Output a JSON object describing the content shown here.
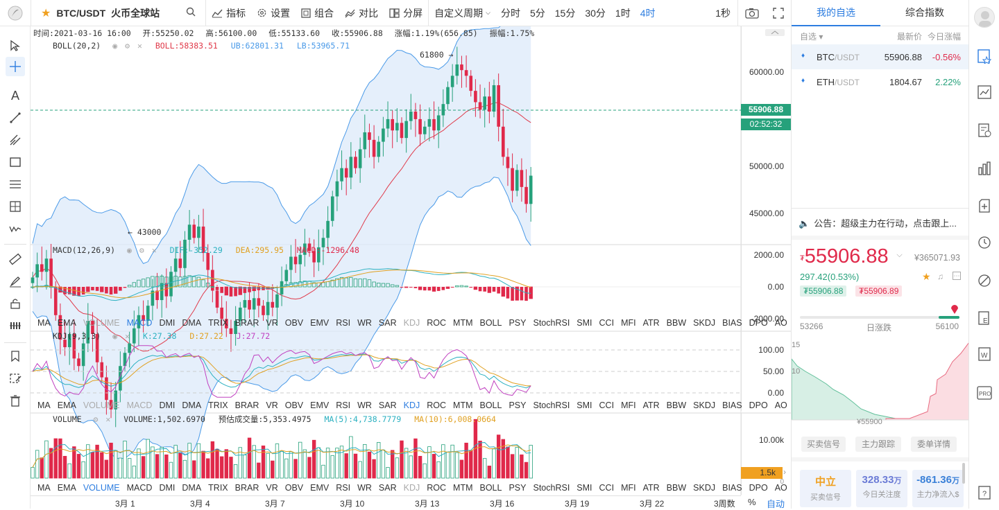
{
  "topbar": {
    "symbol": "BTC/USDT",
    "site": "火币全球站",
    "indicators_label": "指标",
    "settings_label": "设置",
    "combine_label": "组合",
    "compare_label": "对比",
    "split_label": "分屏",
    "custom_period_label": "自定义周期",
    "periods": [
      "分时",
      "5分",
      "15分",
      "30分",
      "1时",
      "4时"
    ],
    "active_period": "4时",
    "second_label": "1秒"
  },
  "info": {
    "time_label": "时间:",
    "time": "2021-03-16 16:00",
    "open_label": "开:",
    "open": "55250.02",
    "high_label": "高:",
    "high": "56100.00",
    "low_label": "低:",
    "low": "55133.60",
    "close_label": "收:",
    "close": "55906.88",
    "change_label": "涨幅:",
    "change": "1.19%(656.85)",
    "amp_label": "振幅:",
    "amp": "1.75%"
  },
  "boll": {
    "name": "BOLL(20,2)",
    "boll": "BOLL:58383.51",
    "ub": "UB:62801.31",
    "lb": "LB:53965.71",
    "max_mark": "61800",
    "min_mark": "43000"
  },
  "price_axis": [
    "60000.00",
    "55906.88",
    "50000.00",
    "45000.00"
  ],
  "countdown": "02:52:32",
  "macd": {
    "name": "MACD(12,26,9)",
    "dif": "DIF:-352.29",
    "dea": "DEA:295.95",
    "macd": "MACD:-1296.48",
    "axis": [
      "2000.00",
      "0.00",
      "-2000.00"
    ]
  },
  "kdj": {
    "name": "KDJ(9,3,3)",
    "k": "K:27.38",
    "d": "D:27.22",
    "j": "J:27.72",
    "axis": [
      "100.00",
      "50.00",
      "0.00"
    ]
  },
  "volume": {
    "name": "VOLUME",
    "vol": "VOLUME:1,502.6970",
    "est": "预估成交量:5,353.4975",
    "ma5": "MA(5):4,738.7779",
    "ma10": "MA(10):6,008.0664",
    "axis": [
      "10.00k",
      "1.5k",
      "0"
    ]
  },
  "indicator_tabs": [
    "MA",
    "EMA",
    "VOLUME",
    "MACD",
    "DMI",
    "DMA",
    "TRIX",
    "BRAR",
    "VR",
    "OBV",
    "EMV",
    "RSI",
    "WR",
    "SAR",
    "KDJ",
    "ROC",
    "MTM",
    "BOLL",
    "PSY",
    "StochRSI",
    "SMI",
    "CCI",
    "MFI",
    "ATR",
    "BBW",
    "SKDJ",
    "BIAS",
    "DPO",
    "AO"
  ],
  "date_axis": [
    "3月 1",
    "3月 4",
    "3月 7",
    "3月 10",
    "3月 13",
    "3月 16",
    "3月 19",
    "3月 22",
    "3周数"
  ],
  "bottom_right": {
    "percent": "%",
    "auto": "自动"
  },
  "watchlist": {
    "tab_mine": "我的自选",
    "tab_index": "综合指数",
    "col_select": "自选",
    "col_price": "最新价",
    "col_change": "今日涨幅",
    "rows": [
      {
        "base": "BTC",
        "quote": "/USDT",
        "price": "55906.88",
        "change": "-0.56%",
        "color": "#e0294a"
      },
      {
        "base": "ETH",
        "quote": "/USDT",
        "price": "1804.67",
        "change": "2.22%",
        "color": "#26a17b"
      }
    ]
  },
  "notice": "公告：超级主力在行动，点击跟上...",
  "quote": {
    "price": "55906.88",
    "currency_symbol": "₮",
    "cny": "¥365071.93",
    "change": "297.42(0.53%)",
    "bid": "₮55906.88",
    "ask": "₮55906.89",
    "low": "53266",
    "high": "56100",
    "range_label": "日涨跌",
    "range_fill": 0.97
  },
  "depth_chart": {
    "y_labels": [
      "15",
      "10"
    ],
    "mid_label": "¥55900"
  },
  "buttons": [
    "买卖信号",
    "主力跟踪",
    "委单详情"
  ],
  "stats": [
    {
      "value": "中立",
      "label": "买卖信号",
      "color": "#f0a020"
    },
    {
      "value": "328.33",
      "unit": "万",
      "label": "今日关注度",
      "color": "#6b7bd6"
    },
    {
      "value": "-861.36",
      "unit": "万",
      "label": "主力净流入$",
      "color": "#3a80d8"
    }
  ],
  "colors": {
    "up": "#26a17b",
    "down": "#e0294a",
    "accent": "#2d7de0",
    "boll_mid": "#e03a4a",
    "boll_band": "#4a9ae8",
    "dif": "#2ab0c0",
    "dea": "#e0a020"
  }
}
